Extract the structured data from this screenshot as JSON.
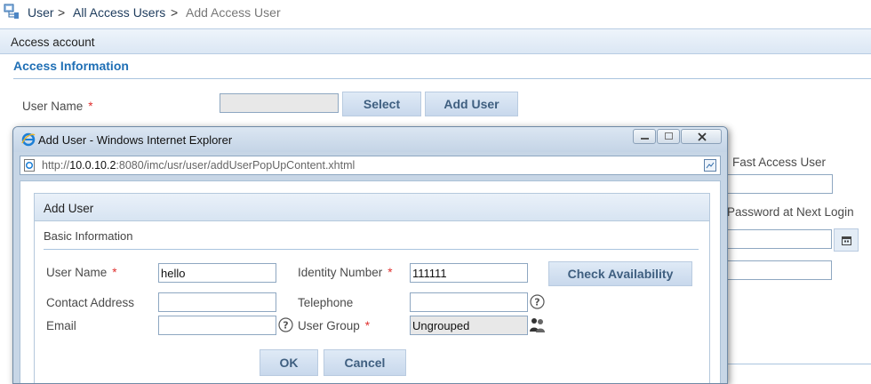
{
  "breadcrumb": {
    "root": "User",
    "sep1": ">",
    "mid": "All Access Users",
    "sep2": ">",
    "current": "Add Access User"
  },
  "panel": {
    "title": "Access account",
    "section": "Access Information"
  },
  "bg_form": {
    "user_name_label": "User Name",
    "required_mark": "*",
    "select_label": "Select",
    "add_user_label": "Add User",
    "fast_access_label": "Fast Access User",
    "password_next_login_label": "Password at Next Login"
  },
  "popup": {
    "window_title": "Add User - Windows Internet Explorer",
    "url_prefix": "http://",
    "url_host": "10.0.10.2",
    "url_rest": ":8080/imc/usr/user/addUserPopUpContent.xhtml",
    "dialog_title": "Add User",
    "section_title": "Basic Information",
    "fields": {
      "user_name_label": "User Name",
      "user_name_value": "hello",
      "identity_label": "Identity Number",
      "identity_value": "111111",
      "check_label": "Check Availability",
      "contact_label": "Contact Address",
      "contact_value": "",
      "telephone_label": "Telephone",
      "telephone_value": "",
      "email_label": "Email",
      "email_value": "",
      "group_label": "User Group",
      "group_value": "Ungrouped"
    },
    "ok_label": "OK",
    "cancel_label": "Cancel"
  },
  "colors": {
    "accent": "#1f6fb5",
    "panel_header": "#dfeaf6",
    "button": "#c8d8ec",
    "required": "#e0312f"
  }
}
